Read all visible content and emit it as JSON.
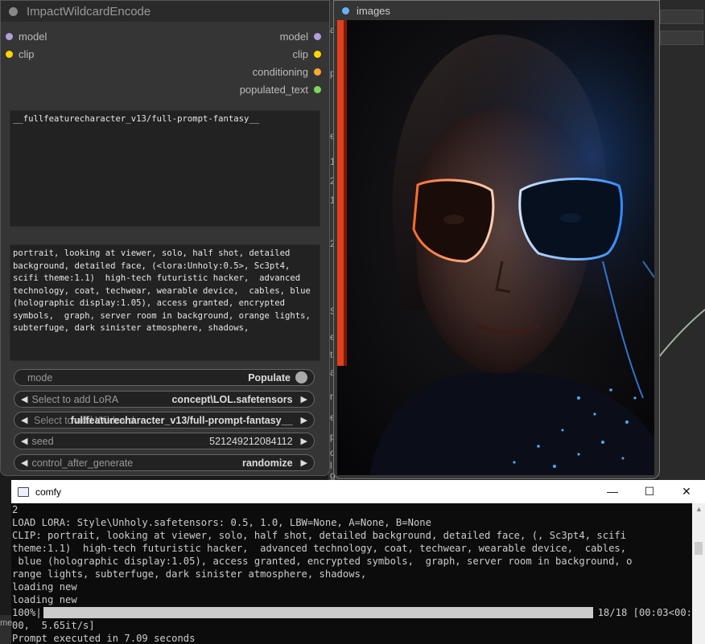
{
  "wildcard_node": {
    "title": "ImpactWildcardEncode",
    "inputs": [
      {
        "label": "model",
        "color": "#b39ddb"
      },
      {
        "label": "clip",
        "color": "#ffd500"
      }
    ],
    "outputs": [
      {
        "label": "model",
        "color": "#b39ddb"
      },
      {
        "label": "clip",
        "color": "#ffd500"
      },
      {
        "label": "conditioning",
        "color": "#ffa931"
      },
      {
        "label": "populated_text",
        "color": "#7ed957"
      }
    ],
    "wildcard_text": "__fullfeaturecharacter_v13/full-prompt-fantasy__",
    "populated_text": "portrait, looking at viewer, solo, half shot, detailed background, detailed face, (<lora:Unholy:0.5>, Sc3pt4, scifi theme:1.1)  high-tech futuristic hacker,  advanced technology, coat, techwear, wearable device,  cables, blue (holographic display:1.05), access granted, encrypted symbols,  graph, server room in background, orange lights, subterfuge, dark sinister atmosphere, shadows,",
    "widgets": {
      "mode": {
        "label": "mode",
        "value": "Populate"
      },
      "lora": {
        "label": "Select to add LoRA",
        "value": "concept\\LOL.safetensors"
      },
      "wildcard": {
        "label": "Select to add Wildcard",
        "value": "fullfeaturecharacter_v13/full-prompt-fantasy__"
      },
      "seed": {
        "label": "seed",
        "value": "521249212084112"
      },
      "control": {
        "label": "control_after_generate",
        "value": "randomize"
      }
    }
  },
  "image_node": {
    "title": "images",
    "slot_color": "#6ab0f3"
  },
  "side_letters": [
    "a",
    "pl",
    "e",
    "1",
    "2",
    "1",
    "2",
    "S",
    "e",
    "ti",
    "at",
    "m",
    "e",
    "pa",
    "ori",
    "l",
    "g"
  ],
  "console": {
    "title": "comfy",
    "controls": {
      "minimize": "—",
      "maximize": "☐",
      "close": "✕"
    },
    "lines": [
      "2",
      "LOAD LORA: Style\\Unholy.safetensors: 0.5, 1.0, LBW=None, A=None, B=None",
      "CLIP: portrait, looking at viewer, solo, half shot, detailed background, detailed face, (, Sc3pt4, scifi",
      "theme:1.1)  high-tech futuristic hacker,  advanced technology, coat, techwear, wearable device,  cables,",
      " blue (holographic display:1.05), access granted, encrypted symbols,  graph, server room in background, o",
      "range lights, subterfuge, dark sinister atmosphere, shadows,",
      "loading new",
      "loading new"
    ],
    "progress": {
      "percent_label": "100%|",
      "fraction": 1.0,
      "tail": "18/18 [00:03<00:"
    },
    "after_progress": [
      "00,  5.65it/s]",
      "Prompt executed in 7.09 seconds"
    ],
    "left_tab": "me"
  }
}
